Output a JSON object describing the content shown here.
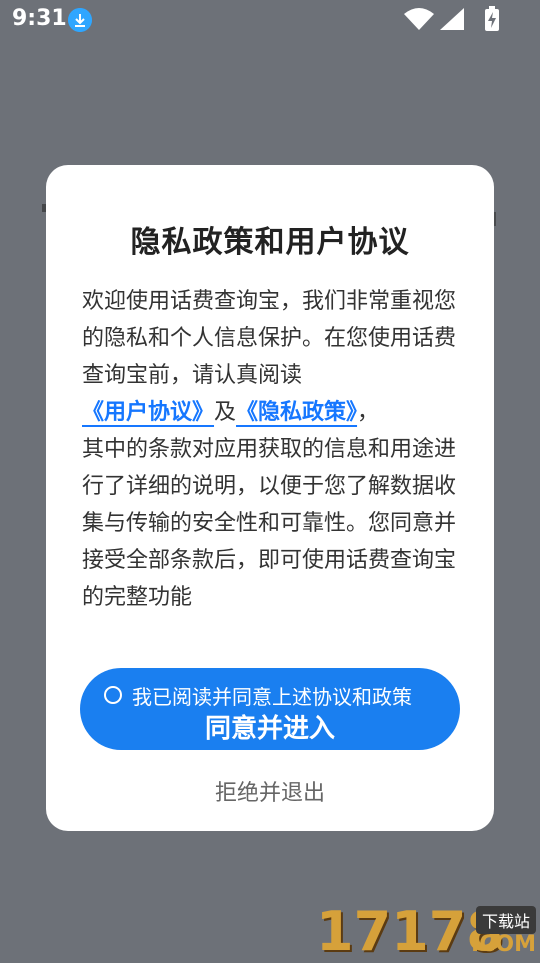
{
  "status_bar": {
    "time": "9:31",
    "icons": [
      "download-icon",
      "wifi-icon",
      "signal-icon",
      "battery-charging-icon"
    ]
  },
  "dialog": {
    "title": "隐私政策和用户协议",
    "paragraph_1": "欢迎使用话费查询宝，我们非常重视您的隐私和个人信息保护。在您使用话费查询宝前，请认真阅读",
    "link_user_agreement": "《用户协议》",
    "connector": "及",
    "link_privacy_policy": "《隐私政策》",
    "comma": "，",
    "paragraph_2": "其中的条款对应用获取的信息和用途进行了详细的说明，以便于您了解数据收集与传输的安全性和可靠性。您同意并接受全部条款后，即可使用话费查询宝的完整功能",
    "agree_checkbox_label": "我已阅读并同意上述协议和政策",
    "agree_button_label": "同意并进入",
    "reject_label": "拒绝并退出"
  },
  "watermark": {
    "number": "17178",
    "tag": "下载站",
    "domain": ".COM"
  },
  "colors": {
    "accent": "#1a7ff0",
    "link": "#1677ff",
    "backdrop": "#6d7178"
  }
}
